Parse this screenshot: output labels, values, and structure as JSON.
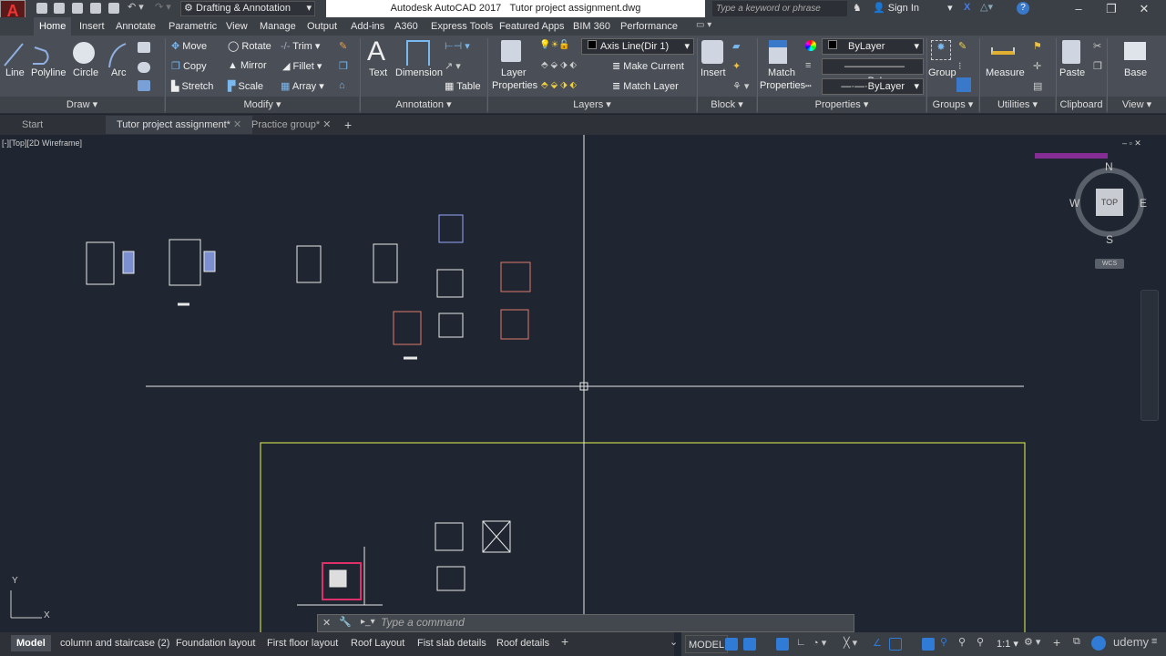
{
  "app": {
    "logo": "A",
    "title": "Autodesk AutoCAD 2017",
    "document": "Tutor project assignment.dwg",
    "workspace": "Drafting & Annotation",
    "search_placeholder": "Type a keyword or phrase",
    "sign_in": "Sign In"
  },
  "ribbon_tabs": [
    "Home",
    "Insert",
    "Annotate",
    "Parametric",
    "View",
    "Manage",
    "Output",
    "Add-ins",
    "A360",
    "Express Tools",
    "Featured Apps",
    "BIM 360",
    "Performance"
  ],
  "draw": {
    "line": "Line",
    "polyline": "Polyline",
    "circle": "Circle",
    "arc": "Arc",
    "label": "Draw"
  },
  "modify": {
    "move": "Move",
    "rotate": "Rotate",
    "trim": "Trim",
    "copy": "Copy",
    "mirror": "Mirror",
    "fillet": "Fillet",
    "stretch": "Stretch",
    "scale": "Scale",
    "array": "Array",
    "label": "Modify"
  },
  "annotation": {
    "text": "Text",
    "dimension": "Dimension",
    "table": "Table",
    "label": "Annotation"
  },
  "layers": {
    "layer_properties_1": "Layer",
    "layer_properties_2": "Properties",
    "current_layer": "Axis Line(Dir 1)",
    "make_current": "Make Current",
    "match_layer": "Match Layer",
    "label": "Layers"
  },
  "block": {
    "insert": "Insert",
    "label": "Block"
  },
  "properties": {
    "match_1": "Match",
    "match_2": "Properties",
    "color": "ByLayer",
    "lineweight": "ByLayer",
    "linetype": "ByLayer",
    "label": "Properties"
  },
  "groups": {
    "group": "Group",
    "label": "Groups"
  },
  "utilities": {
    "measure": "Measure",
    "label": "Utilities"
  },
  "clipboard": {
    "paste": "Paste",
    "label": "Clipboard"
  },
  "view": {
    "base": "Base",
    "label": "View"
  },
  "file_tabs": [
    "Start",
    "Tutor project assignment*",
    "Practice group*"
  ],
  "viewport": {
    "label": "[-][Top][2D Wireframe]",
    "compass": {
      "n": "N",
      "s": "S",
      "e": "E",
      "w": "W",
      "top": "TOP",
      "wcs": "WCS"
    },
    "ucs_x": "X",
    "ucs_y": "Y"
  },
  "command": {
    "placeholder": "Type a command"
  },
  "layout_tabs": [
    "Model",
    "column and staircase (2)",
    "Foundation layout",
    "First floor layout",
    "Roof Layout",
    "Fist slab details",
    "Roof details"
  ],
  "status": {
    "model": "MODEL",
    "scale": "1:1"
  },
  "watermark": "udemy",
  "colors": {
    "accent": "#2f7bd6",
    "viewport": "#1f2631",
    "layout_frame": "#c8d34a"
  }
}
